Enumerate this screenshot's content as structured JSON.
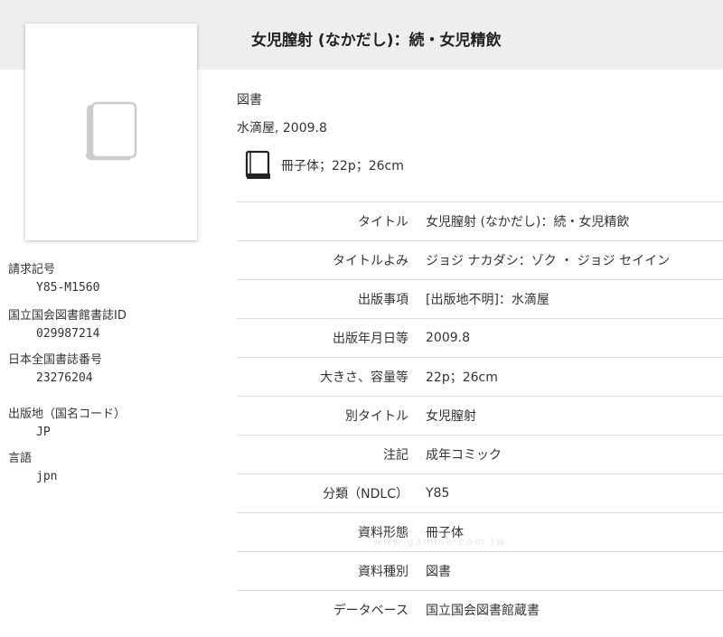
{
  "title": "女児膣射 (なかだし)：続・女児精飲",
  "summary": {
    "material_type": "図書",
    "publisher_date": "水滴屋, 2009.8",
    "format": "冊子体；22p；26cm"
  },
  "icons": {
    "cover": "book-placeholder-icon",
    "format": "book-icon"
  },
  "left_meta": [
    {
      "label": "請求記号",
      "value": "Y85-M1560"
    },
    {
      "label": "国立国会図書館書誌ID",
      "value": "029987214"
    },
    {
      "label": "日本全国書誌番号",
      "value": "23276204"
    },
    {
      "label": "出版地（国名コード）",
      "value": "JP"
    },
    {
      "label": "言語",
      "value": "jpn"
    }
  ],
  "details": [
    {
      "key": "タイトル",
      "value": "女児膣射 (なかだし)：続・女児精飲"
    },
    {
      "key": "タイトルよみ",
      "value": "ジョジ ナカダシ：ゾク ・ ジョジ セイイン"
    },
    {
      "key": "出版事項",
      "value": "[出版地不明]：水滴屋"
    },
    {
      "key": "出版年月日等",
      "value": "2009.8"
    },
    {
      "key": "大きさ、容量等",
      "value": "22p；26cm"
    },
    {
      "key": "別タイトル",
      "value": "女児膣射"
    },
    {
      "key": "注記",
      "value": "成年コミック"
    },
    {
      "key": "分類（NDLC）",
      "value": "Y85"
    },
    {
      "key": "資料形態",
      "value": "冊子体"
    },
    {
      "key": "資料種別",
      "value": "図書"
    },
    {
      "key": "データベース",
      "value": "国立国会図書館蔵書"
    }
  ],
  "watermark": "www.gamme.com.tw",
  "colors": {
    "header_bg": "#eeeeee",
    "row_divider": "#dddddd",
    "text": "#333333"
  }
}
